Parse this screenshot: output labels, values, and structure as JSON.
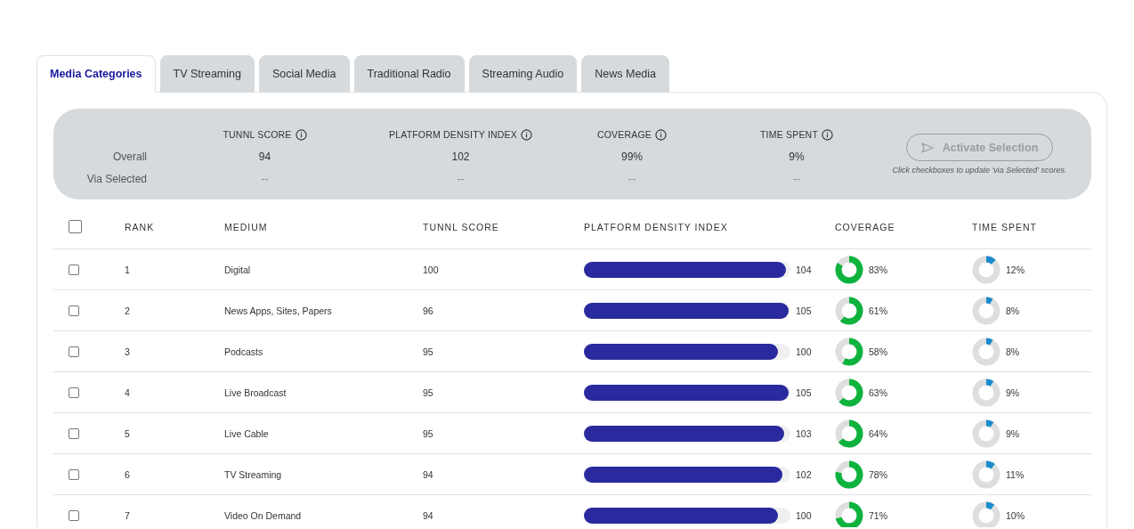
{
  "tabs": [
    {
      "label": "Media Categories",
      "selected": true
    },
    {
      "label": "TV Streaming",
      "selected": false
    },
    {
      "label": "Social Media",
      "selected": false
    },
    {
      "label": "Traditional Radio",
      "selected": false
    },
    {
      "label": "Streaming Audio",
      "selected": false
    },
    {
      "label": "News Media",
      "selected": false
    }
  ],
  "summary": {
    "row_labels": [
      "Overall",
      "Via Selected"
    ],
    "metrics": [
      {
        "label": "TUNNL SCORE",
        "overall": "94",
        "via_selected": "--"
      },
      {
        "label": "PLATFORM DENSITY INDEX",
        "overall": "102",
        "via_selected": "--"
      },
      {
        "label": "COVERAGE",
        "overall": "99%",
        "via_selected": "--"
      },
      {
        "label": "TIME SPENT",
        "overall": "9%",
        "via_selected": "--"
      }
    ],
    "button": {
      "label": "Activate Selection",
      "disabled": true
    },
    "hint": "Click checkboxes to update 'via Selected' scores."
  },
  "table": {
    "select_all": {
      "checked": false
    },
    "columns": [
      "RANK",
      "MEDIUM",
      "TUNNL SCORE",
      "PLATFORM DENSITY INDEX",
      "COVERAGE",
      "TIME SPENT"
    ],
    "rows": [
      {
        "checked": false,
        "rank": "1",
        "medium": "Digital",
        "score": "100",
        "pdi": {
          "level": 0.98,
          "value": "104"
        },
        "coverage": "83%",
        "time_spent": "12%"
      },
      {
        "checked": false,
        "rank": "2",
        "medium": "News Apps, Sites, Papers",
        "score": "96",
        "pdi": {
          "level": 0.99,
          "value": "105"
        },
        "coverage": "61%",
        "time_spent": "8%"
      },
      {
        "checked": false,
        "rank": "3",
        "medium": "Podcasts",
        "score": "95",
        "pdi": {
          "level": 0.94,
          "value": "100"
        },
        "coverage": "58%",
        "time_spent": "8%"
      },
      {
        "checked": false,
        "rank": "4",
        "medium": "Live Broadcast",
        "score": "95",
        "pdi": {
          "level": 0.99,
          "value": "105"
        },
        "coverage": "63%",
        "time_spent": "9%"
      },
      {
        "checked": false,
        "rank": "5",
        "medium": "Live Cable",
        "score": "95",
        "pdi": {
          "level": 0.97,
          "value": "103"
        },
        "coverage": "64%",
        "time_spent": "9%"
      },
      {
        "checked": false,
        "rank": "6",
        "medium": "TV Streaming",
        "score": "94",
        "pdi": {
          "level": 0.96,
          "value": "102"
        },
        "coverage": "78%",
        "time_spent": "11%"
      },
      {
        "checked": false,
        "rank": "7",
        "medium": "Video On Demand",
        "score": "94",
        "pdi": {
          "level": 0.94,
          "value": "100"
        },
        "coverage": "71%",
        "time_spent": "10%"
      }
    ]
  }
}
